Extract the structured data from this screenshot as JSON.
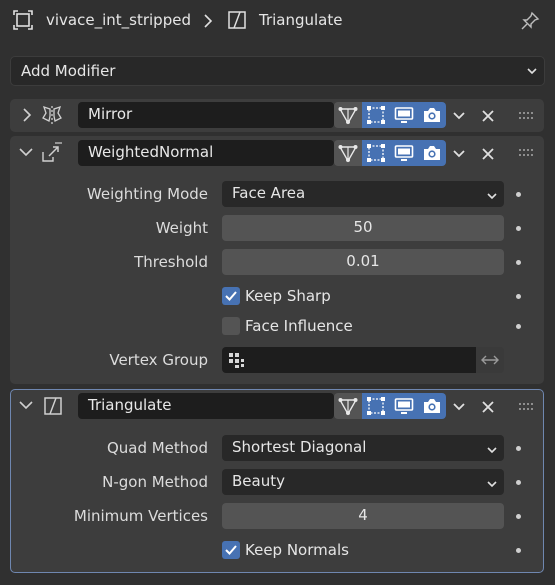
{
  "header": {
    "object_name": "vivace_int_stripped",
    "modifier_name": "Triangulate"
  },
  "add_modifier": {
    "label": "Add Modifier"
  },
  "modifiers": [
    {
      "name": "Mirror",
      "expanded": false
    },
    {
      "name": "WeightedNormal",
      "expanded": true,
      "weighting_mode": {
        "label": "Weighting Mode",
        "value": "Face Area"
      },
      "weight": {
        "label": "Weight",
        "value": "50"
      },
      "threshold": {
        "label": "Threshold",
        "value": "0.01"
      },
      "keep_sharp": {
        "label": "Keep Sharp",
        "checked": true
      },
      "face_influence": {
        "label": "Face Influence",
        "checked": false
      },
      "vertex_group": {
        "label": "Vertex Group",
        "value": ""
      }
    },
    {
      "name": "Triangulate",
      "expanded": true,
      "active": true,
      "quad_method": {
        "label": "Quad Method",
        "value": "Shortest Diagonal"
      },
      "ngon_method": {
        "label": "N-gon Method",
        "value": "Beauty"
      },
      "min_vertices": {
        "label": "Minimum Vertices",
        "value": "4"
      },
      "keep_normals": {
        "label": "Keep Normals",
        "checked": true
      }
    }
  ],
  "colors": {
    "background": "#303030",
    "panel": "#3d3d3d",
    "accent": "#4772b3",
    "active_outline": "#6f87b0"
  }
}
